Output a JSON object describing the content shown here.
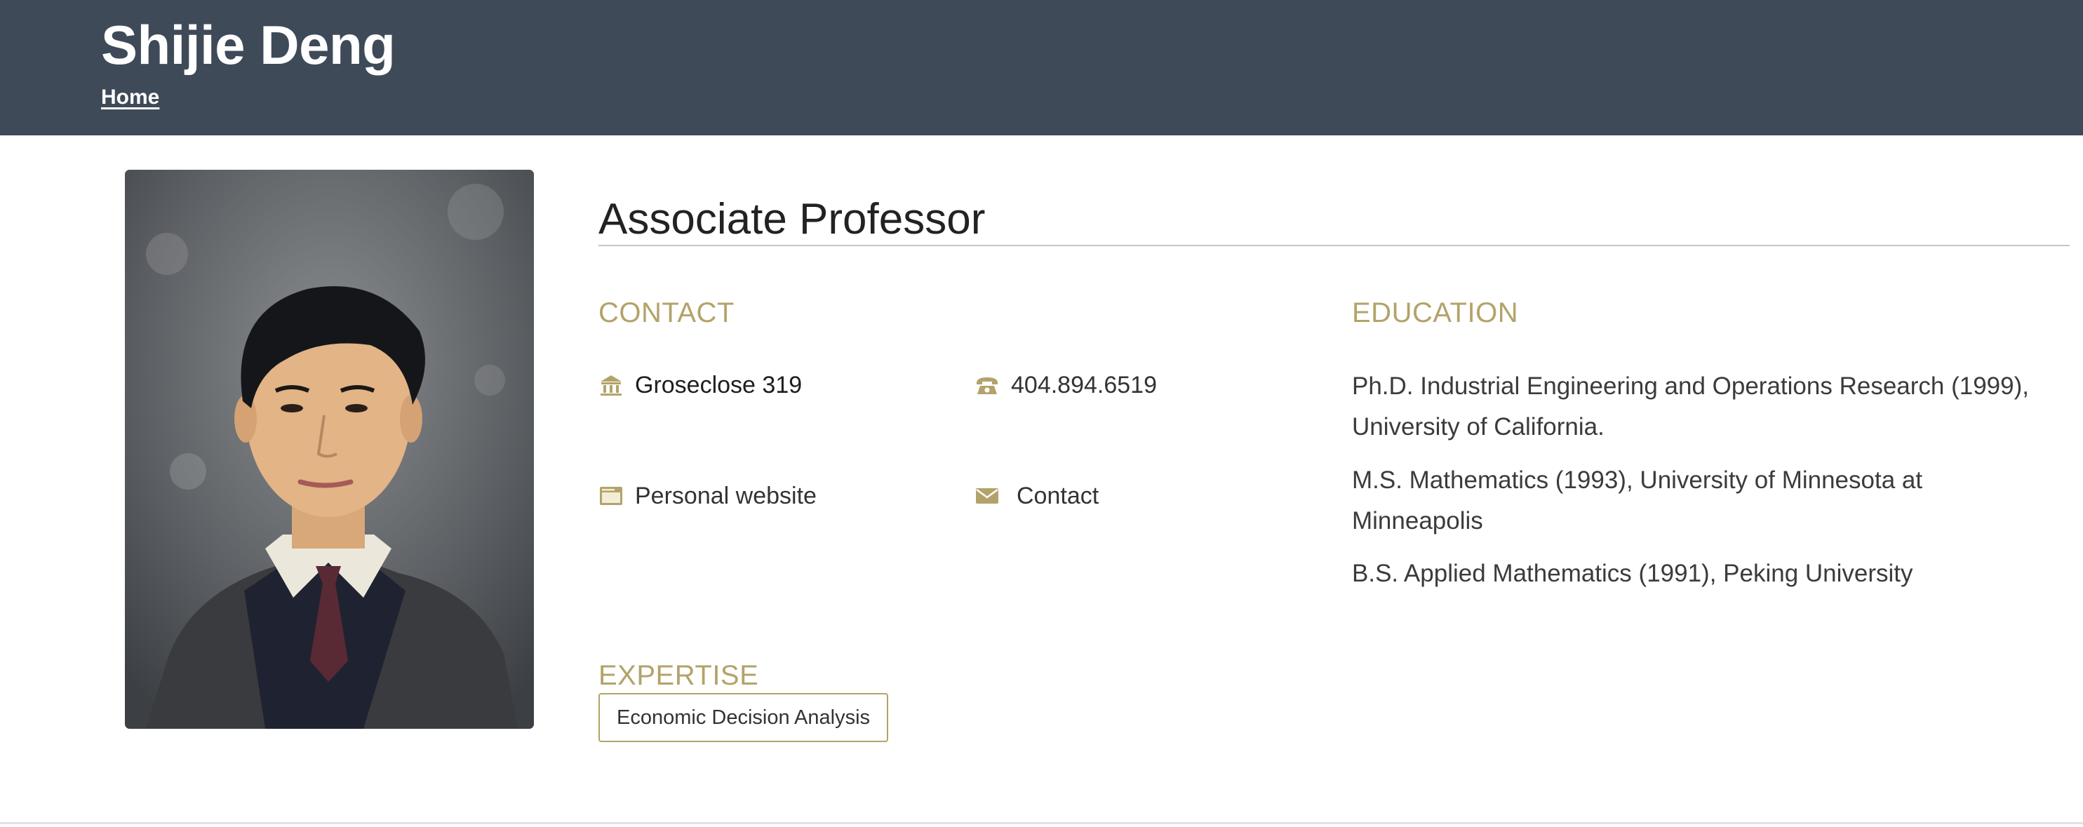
{
  "header": {
    "site_title": "Shijie Deng",
    "home_link": "Home",
    "background_color": "#3f4a58"
  },
  "profile": {
    "photo_alt": "Shijie Deng",
    "job_title": "Associate Professor"
  },
  "contact": {
    "heading": "CONTACT",
    "office": {
      "icon": "building-icon",
      "label": "Groseclose 319"
    },
    "phone": {
      "icon": "phone-icon",
      "label": "404.894.6519"
    },
    "website": {
      "icon": "browser-icon",
      "label": "Personal website"
    },
    "email": {
      "icon": "envelope-icon",
      "label": "Contact"
    }
  },
  "education": {
    "heading": "EDUCATION",
    "items": [
      {
        "line1": "Ph.D. Industrial Engineering and Operations Research (1999),",
        "line2": "University of California."
      },
      {
        "line1": "M.S. Mathematics (1993), University of Minnesota at",
        "line2": "Minneapolis"
      },
      {
        "line1": "B.S. Applied Mathematics (1991), Peking University",
        "line2": ""
      }
    ]
  },
  "expertise": {
    "heading": "EXPERTISE",
    "tags": [
      "Economic Decision Analysis"
    ]
  },
  "colors": {
    "accent": "#b3a36a",
    "header": "#3f4a58",
    "text": "#262626"
  }
}
